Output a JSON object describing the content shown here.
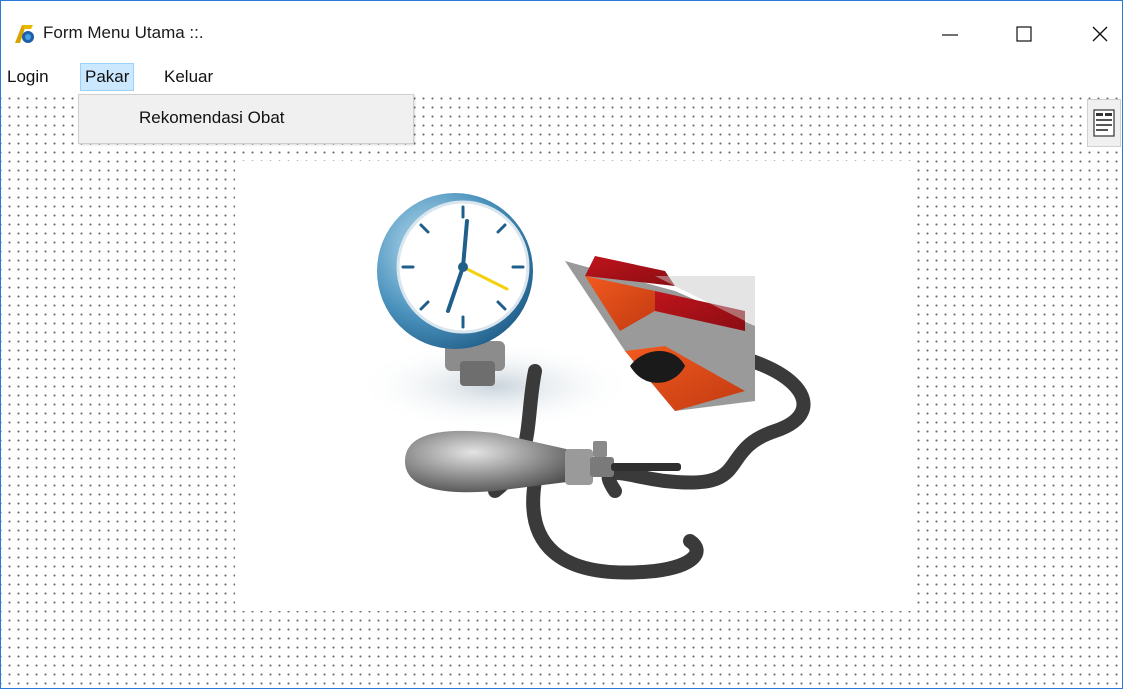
{
  "window": {
    "title": "Form Menu Utama ::.",
    "controls": [
      "minimize-icon",
      "maximize-icon",
      "close-icon"
    ],
    "border_color": "#2b79d6"
  },
  "menubar": {
    "items": [
      {
        "label": "Login"
      },
      {
        "label": "Pakar",
        "active": true
      },
      {
        "label": "Keluar"
      }
    ]
  },
  "dropdown": {
    "items": [
      {
        "label": "Rekomendasi Obat"
      }
    ]
  },
  "colors": {
    "menu_highlight": "#cce8ff",
    "menu_highlight_border": "#99d1ff",
    "dropdown_bg": "#f0f0f0"
  },
  "icons": {
    "app": "app-icon",
    "toolbar": "properties-icon",
    "picture": "sphygmomanometer-image"
  }
}
